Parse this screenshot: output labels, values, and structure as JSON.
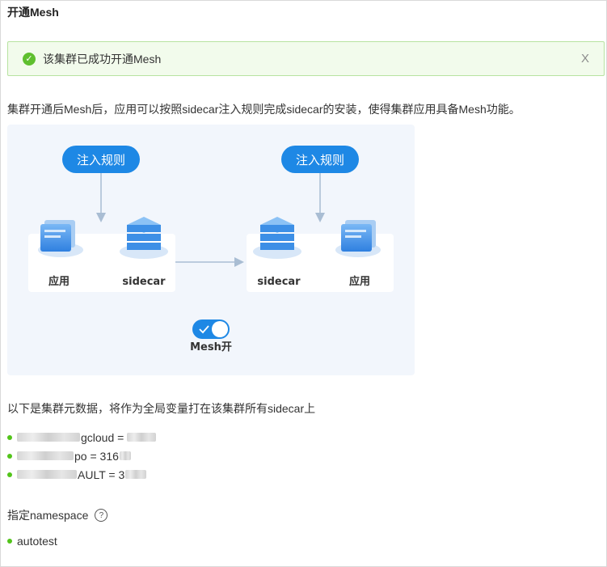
{
  "header": {
    "title": "开通Mesh"
  },
  "alert": {
    "message": "该集群已成功开通Mesh",
    "close_label": "X",
    "color": "#5fbf2f"
  },
  "description": "集群开通后Mesh后，应用可以按照sidecar注入规则完成sidecar的安装，使得集群应用具备Mesh功能。",
  "diagram": {
    "inject_label": "注入规则",
    "app_label": "应用",
    "sidecar_label": "sidecar",
    "switch_label": "Mesh开",
    "accent": "#1e88e5"
  },
  "metadata": {
    "title": "以下是集群元数据，将作为全局变量打在该集群所有sidecar上",
    "items": [
      {
        "visible_text": "gcloud ="
      },
      {
        "visible_text": "po = 316"
      },
      {
        "visible_text": "AULT = 3"
      }
    ]
  },
  "namespace": {
    "label": "指定namespace",
    "help_icon": "question-circle-icon",
    "items": [
      "autotest"
    ]
  }
}
